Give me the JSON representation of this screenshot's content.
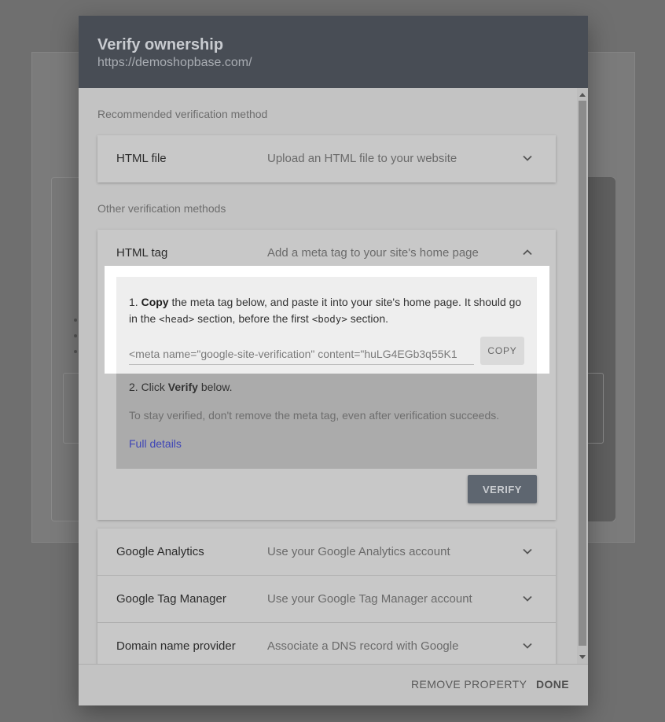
{
  "dialog": {
    "title": "Verify ownership",
    "url": "https://demoshopbase.com/"
  },
  "recommended_label": "Recommended verification method",
  "other_label": "Other verification methods",
  "methods": {
    "html_file": {
      "title": "HTML file",
      "desc": "Upload an HTML file to your website",
      "icon": "chevron-down-icon"
    },
    "html_tag": {
      "title": "HTML tag",
      "desc": "Add a meta tag to your site's home page",
      "icon": "chevron-up-icon"
    },
    "google_analytics": {
      "title": "Google Analytics",
      "desc": "Use your Google Analytics account",
      "icon": "chevron-down-icon"
    },
    "tag_manager": {
      "title": "Google Tag Manager",
      "desc": "Use your Google Tag Manager account",
      "icon": "chevron-down-icon"
    },
    "domain_provider": {
      "title": "Domain name provider",
      "desc": "Associate a DNS record with Google",
      "icon": "chevron-down-icon"
    }
  },
  "html_tag_panel": {
    "step1_num": "1.",
    "step1_bold": "Copy",
    "step1_text_a": " the meta tag below, and paste it into your site's home page. It should go in the ",
    "step1_code_head": "<head>",
    "step1_text_b": " section, before the first ",
    "step1_code_body": "<body>",
    "step1_text_c": " section.",
    "meta_tag_value": "<meta name=\"google-site-verification\" content=\"huLG4EGb3q55K1",
    "copy_label": "COPY",
    "step2_text_a": "2. Click ",
    "step2_bold": "Verify",
    "step2_text_b": " below.",
    "note": "To stay verified, don't remove the meta tag, even after verification succeeds.",
    "full_details": "Full details",
    "verify_label": "VERIFY"
  },
  "footer": {
    "remove_label": "REMOVE PROPERTY",
    "done_label": "DONE"
  },
  "colors": {
    "header": "#484d55",
    "link": "#3e45b6",
    "verify_button": "#5e6670"
  }
}
